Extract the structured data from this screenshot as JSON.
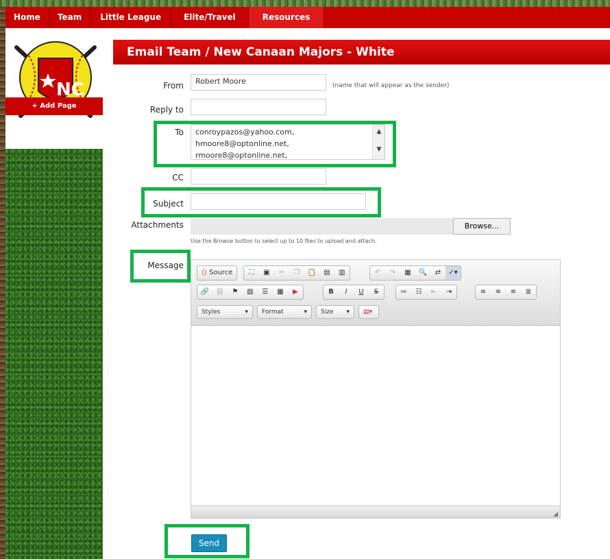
{
  "nav": [
    "Home",
    "Team",
    "Little League",
    "Elite/Travel",
    "Resources"
  ],
  "sidebar": {
    "add_page": "+ Add Page",
    "logo_text": "NC"
  },
  "header": {
    "title": "Email Team / New Canaan Majors - White"
  },
  "form": {
    "from_label": "From",
    "from_value": "Robert Moore",
    "from_hint": "(name that will appear as the sender)",
    "reply_label": "Reply to",
    "to_label": "To",
    "to_lines": [
      "conroypazos@yahoo.com,",
      "hmoore8@optonline.net,",
      "rmoore8@optonline.net,"
    ],
    "cc_label": "CC",
    "subject_label": "Subject",
    "attach_label": "Attachments",
    "browse": "Browse...",
    "attach_hint": "Use the Browse button to select up to 10 files to upload and attach.",
    "message_label": "Message",
    "send": "Send"
  },
  "editor": {
    "source": "Source",
    "combos": [
      "Styles",
      "Format",
      "Size"
    ],
    "format_buttons": [
      "B",
      "I",
      "U",
      "S"
    ]
  },
  "colors": {
    "nav_red": "#c90000",
    "highlight": "#15b24a",
    "send_blue": "#1a8cb8"
  }
}
